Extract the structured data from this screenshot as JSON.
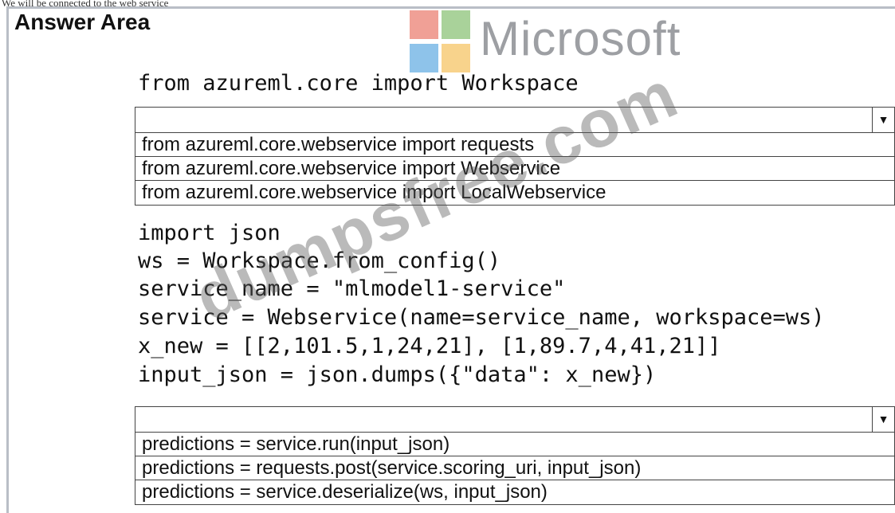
{
  "top_strip_text": "We will be connected to the web service",
  "answer_area": {
    "title": "Answer Area"
  },
  "logo": {
    "text": "Microsoft"
  },
  "watermark": "dumpsfree.com",
  "code_lines_top": [
    "from azureml.core import Workspace"
  ],
  "dropdown1": {
    "selected": "",
    "options": [
      "from azureml.core.webservice import requests",
      "from azureml.core.webservice import Webservice",
      "from azureml.core.webservice import LocalWebservice"
    ]
  },
  "code_lines_middle": [
    "import json",
    "ws = Workspace.from_config()",
    "service_name = \"mlmodel1-service\"",
    "service = Webservice(name=service_name, workspace=ws)",
    "x_new = [[2,101.5,1,24,21], [1,89.7,4,41,21]]",
    "input_json = json.dumps({\"data\": x_new})"
  ],
  "dropdown2": {
    "selected": "",
    "options": [
      "predictions = service.run(input_json)",
      "predictions = requests.post(service.scoring_uri, input_json)",
      "predictions = service.deserialize(ws, input_json)"
    ]
  }
}
